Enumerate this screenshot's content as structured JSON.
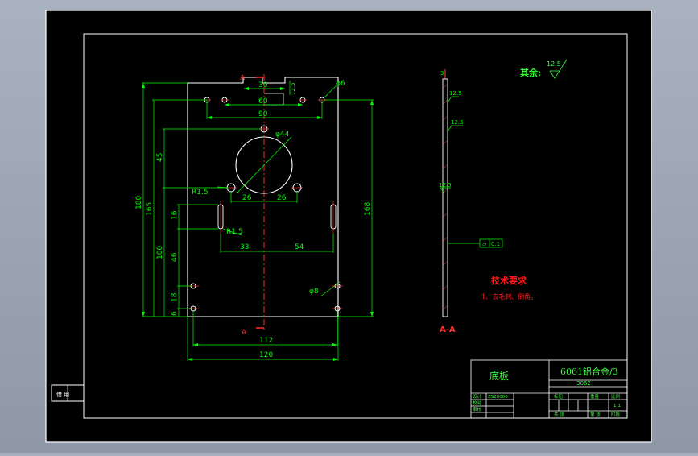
{
  "dims": {
    "d30": "30",
    "d60": "60",
    "d90": "90",
    "d44": "φ44",
    "d26a": "26",
    "d26b": "26",
    "d33": "33",
    "d54": "54",
    "d112": "112",
    "d120": "120",
    "d180": "180",
    "d165": "165",
    "d45": "45",
    "d16": "16",
    "d100": "100",
    "d46": "46",
    "d18": "18",
    "d6": "6",
    "d168": "168",
    "r15a": "R1.5",
    "r15b": "R1.5",
    "phi8": "φ8",
    "phi6": "φ6",
    "rough125": "12.5",
    "roughSide1": "12.5",
    "roughSide2": "12.5",
    "roughSide3": "12.5",
    "sectionTop": "A",
    "sectionBottom": "A",
    "flatness": "0.1",
    "flatnessSym": "⏥",
    "sideTop": "3"
  },
  "notes": {
    "rest_label": "其余:",
    "rest_rough": "12.5",
    "section_label": "A-A",
    "tech_title": "技术要求",
    "tech_item": "1、去毛刺、倒角。"
  },
  "title_block": {
    "part_name": "底板",
    "material": "6061铝合金/3",
    "drawing_no": "3062",
    "design": "设计",
    "check": "校对",
    "review": "审核",
    "designer": "ZS20000",
    "scale_label": "比例",
    "scale": "1:1",
    "mark": "标记",
    "weight": "重量",
    "stage": "阶段",
    "count": "共 张",
    "sheet": "第 张",
    "page_ref": "第 张",
    "left_label": "借 用"
  },
  "colors": {
    "frame": "#ffffff",
    "dim": "#00ff00",
    "center": "#ff2a2a",
    "note_red": "#ff1a1a",
    "note_green": "#33ff33"
  }
}
